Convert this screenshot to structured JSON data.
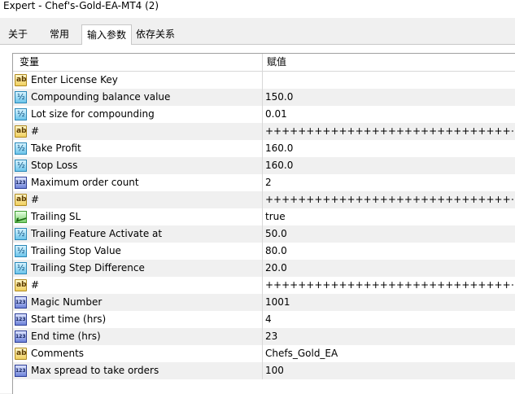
{
  "window": {
    "title": "Expert - Chef's-Gold-EA-MT4 (2)"
  },
  "tabs": [
    {
      "label": "关于"
    },
    {
      "label": "常用"
    },
    {
      "label": "输入参数",
      "active": true
    },
    {
      "label": "依存关系"
    }
  ],
  "table": {
    "columns": {
      "name": "变量",
      "value": "赋值"
    },
    "rows": [
      {
        "icon": "string-ab-icon",
        "name": "Enter License Key",
        "value": ""
      },
      {
        "icon": "double-v2-icon",
        "name": "Compounding balance value",
        "value": "150.0"
      },
      {
        "icon": "double-v2-icon",
        "name": "Lot size for compounding",
        "value": "0.01"
      },
      {
        "icon": "string-ab-icon",
        "name": "#",
        "value": "+++++++++++++++++++++++++++++++..."
      },
      {
        "icon": "double-v2-icon",
        "name": "Take Profit",
        "value": "160.0"
      },
      {
        "icon": "double-v2-icon",
        "name": "Stop Loss",
        "value": "160.0"
      },
      {
        "icon": "integer-123-icon",
        "name": "Maximum order count",
        "value": "2"
      },
      {
        "icon": "string-ab-icon",
        "name": "#",
        "value": "+++++++++++++++++++++++++++++++..."
      },
      {
        "icon": "boolean-check-icon",
        "name": "Trailing SL",
        "value": "true"
      },
      {
        "icon": "double-v2-icon",
        "name": "Trailing Feature Activate at",
        "value": "50.0"
      },
      {
        "icon": "double-v2-icon",
        "name": "Trailing Stop Value",
        "value": "80.0"
      },
      {
        "icon": "double-v2-icon",
        "name": "Trailing Step Difference",
        "value": "20.0"
      },
      {
        "icon": "string-ab-icon",
        "name": "#",
        "value": "+++++++++++++++++++++++++++++++..."
      },
      {
        "icon": "integer-123-icon",
        "name": "Magic Number",
        "value": "1001"
      },
      {
        "icon": "integer-123-icon",
        "name": "Start time (hrs)",
        "value": "4"
      },
      {
        "icon": "integer-123-icon",
        "name": "End time (hrs)",
        "value": "23"
      },
      {
        "icon": "string-ab-icon",
        "name": "Comments",
        "value": "Chefs_Gold_EA"
      },
      {
        "icon": "integer-123-icon",
        "name": "Max spread to take orders",
        "value": "100"
      }
    ]
  }
}
